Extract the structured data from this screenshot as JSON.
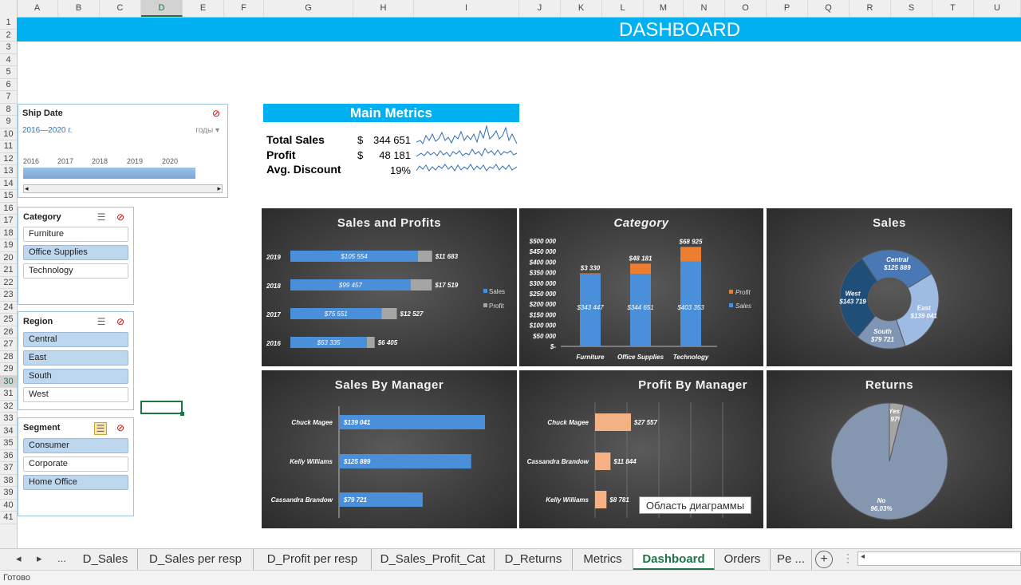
{
  "sheet": {
    "columns": [
      "A",
      "B",
      "C",
      "D",
      "E",
      "F",
      "G",
      "H",
      "I",
      "J",
      "K",
      "L",
      "M",
      "N",
      "O",
      "P",
      "Q",
      "R",
      "S",
      "T",
      "U"
    ],
    "selected_column": "D",
    "rows": [
      "1",
      "2",
      "3",
      "4",
      "5",
      "6",
      "7",
      "8",
      "9",
      "10",
      "11",
      "12",
      "13",
      "14",
      "15",
      "16",
      "17",
      "18",
      "19",
      "20",
      "21",
      "22",
      "23",
      "24",
      "25",
      "26",
      "27",
      "28",
      "29",
      "30",
      "31",
      "32",
      "33",
      "34",
      "35",
      "36",
      "37",
      "38",
      "39",
      "40",
      "41"
    ],
    "selected_row": "30"
  },
  "banner": {
    "title": "DASHBOARD"
  },
  "timeline": {
    "header": "Ship Date",
    "range": "2016—2020 г.",
    "level": "годы ▾",
    "years": [
      "2016",
      "2017",
      "2018",
      "2019",
      "2020"
    ]
  },
  "slicers": {
    "category": {
      "header": "Category",
      "items": [
        {
          "label": "Furniture",
          "selected": false
        },
        {
          "label": "Office Supplies",
          "selected": true
        },
        {
          "label": "Technology",
          "selected": false
        }
      ]
    },
    "region": {
      "header": "Region",
      "items": [
        {
          "label": "Central",
          "selected": true
        },
        {
          "label": "East",
          "selected": true
        },
        {
          "label": "South",
          "selected": true
        },
        {
          "label": "West",
          "selected": false
        }
      ]
    },
    "segment": {
      "header": "Segment",
      "items": [
        {
          "label": "Consumer",
          "selected": true
        },
        {
          "label": "Corporate",
          "selected": false
        },
        {
          "label": "Home Office",
          "selected": true
        }
      ]
    }
  },
  "main_metrics": {
    "title": "Main Metrics",
    "rows": [
      {
        "label": "Total Sales",
        "currency": "$",
        "value": "344 651"
      },
      {
        "label": "Profit",
        "currency": "$",
        "value": "48 181"
      },
      {
        "label": "Avg. Discount",
        "currency": "",
        "value": "19%"
      }
    ]
  },
  "colors": {
    "accent": "#00b0f0",
    "bar_blue": "#4a8fd9",
    "bar_grey": "#a5a5a5",
    "profit_orange": "#ed7d31",
    "peach": "#f4b183",
    "excel_green": "#217346"
  },
  "chart_data": [
    {
      "type": "bar",
      "title": "Sales and Profits",
      "orientation": "horizontal",
      "categories": [
        "2019",
        "2018",
        "2017",
        "2016"
      ],
      "series": [
        {
          "name": "Sales",
          "values": [
            105554,
            99457,
            75551,
            63335
          ],
          "labels": [
            "$105 554",
            "$99 457",
            "$75 551",
            "$63 335"
          ]
        },
        {
          "name": "Profit",
          "values": [
            11683,
            17519,
            12527,
            6405
          ],
          "labels": [
            "$11 683",
            "$17 519",
            "$12 527",
            "$6 405"
          ]
        }
      ],
      "stacked": true,
      "legend": "right"
    },
    {
      "type": "bar",
      "title": "Category",
      "orientation": "vertical",
      "stacked": true,
      "categories": [
        "Furniture",
        "Office Supplies",
        "Technology"
      ],
      "series": [
        {
          "name": "Sales",
          "values": [
            343447,
            344651,
            403353
          ],
          "labels": [
            "$343 447",
            "$344 651",
            "$403 353"
          ]
        },
        {
          "name": "Profit",
          "values": [
            3330,
            48181,
            68925
          ],
          "labels": [
            "$3 330",
            "$48 181",
            "$68 925"
          ]
        }
      ],
      "yticks": [
        "$500 000",
        "$450 000",
        "$400 000",
        "$350 000",
        "$300 000",
        "$250 000",
        "$200 000",
        "$150 000",
        "$100 000",
        "$50 000",
        "$-"
      ],
      "ylim": [
        0,
        500000
      ],
      "legend": "right"
    },
    {
      "type": "pie",
      "title": "Sales",
      "donut": true,
      "slices": [
        {
          "name": "Central",
          "value": 125889,
          "label": "$125 889",
          "color": "#4a78b5"
        },
        {
          "name": "East",
          "value": 139041,
          "label": "$139 041",
          "color": "#9dbbe3"
        },
        {
          "name": "South",
          "value": 79721,
          "label": "$79 721",
          "color": "#7f95b5"
        },
        {
          "name": "West",
          "value": 143719,
          "label": "$143 719",
          "color": "#1f4e79"
        }
      ]
    },
    {
      "type": "bar",
      "title": "Sales By Manager",
      "orientation": "horizontal",
      "categories": [
        "Chuck Magee",
        "Kelly Williams",
        "Cassandra Brandow"
      ],
      "values": [
        139041,
        125889,
        79721
      ],
      "labels": [
        "$139 041",
        "$125 889",
        "$79 721"
      ]
    },
    {
      "type": "bar",
      "title": "Profit By Manager",
      "orientation": "horizontal",
      "categories": [
        "Chuck Magee",
        "Cassandra Brandow",
        "Kelly Williams"
      ],
      "values": [
        27557,
        11844,
        8781
      ],
      "labels": [
        "$27 557",
        "$11 844",
        "$8 781"
      ]
    },
    {
      "type": "pie",
      "title": "Returns",
      "slices": [
        {
          "name": "Yes",
          "value": 3.97,
          "label": "3,97%",
          "color": "#a5a5a5"
        },
        {
          "name": "No",
          "value": 96.03,
          "label": "96,03%",
          "color": "#8496b0"
        }
      ]
    }
  ],
  "tooltip": "Область диаграммы",
  "tabs": {
    "items": [
      "D_Sales",
      "D_Sales per resp",
      "D_Profit per resp",
      "D_Sales_Profit_Cat",
      "D_Returns",
      "Metrics",
      "Dashboard",
      "Orders",
      "Pe ..."
    ],
    "active": "Dashboard",
    "ellipsis": "..."
  },
  "status": {
    "text": "Готово"
  }
}
